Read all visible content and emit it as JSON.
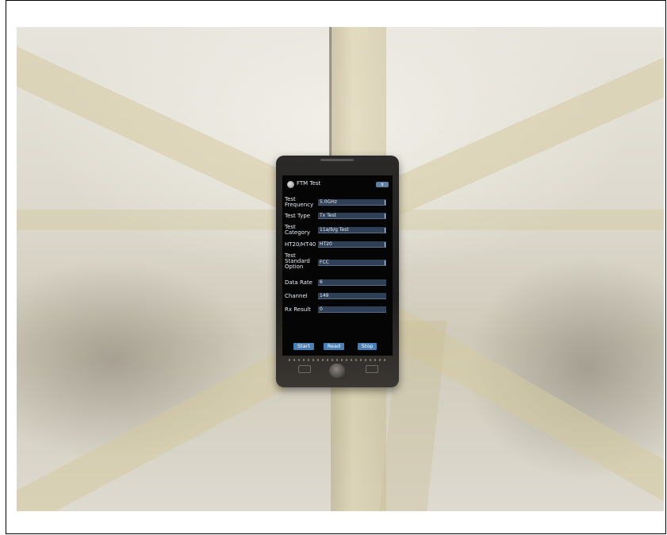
{
  "app": {
    "title": "FTM Test",
    "close_label": "x"
  },
  "form": {
    "test_frequency": {
      "label": "Test\nFrequency",
      "value": "5.0GHz"
    },
    "test_type": {
      "label": "Test Type",
      "value": "Tx Test"
    },
    "test_category": {
      "label": "Test\nCategory",
      "value": "11a/b/g Test"
    },
    "ht_mode": {
      "label": "HT20/HT40",
      "value": "HT20"
    },
    "test_standard": {
      "label": "Test\nStandard\nOption",
      "value": "FCC"
    },
    "data_rate": {
      "label": "Data Rate",
      "value": "6"
    },
    "channel": {
      "label": "Channel",
      "value": "149"
    },
    "rx_result": {
      "label": "Rx Result",
      "value": "0"
    }
  },
  "buttons": {
    "start": "Start",
    "read": "Read",
    "stop": "Stop"
  },
  "colors": {
    "accent": "#4a7fb5",
    "field_bg": "#2f3f55",
    "screen_bg": "#050505"
  }
}
